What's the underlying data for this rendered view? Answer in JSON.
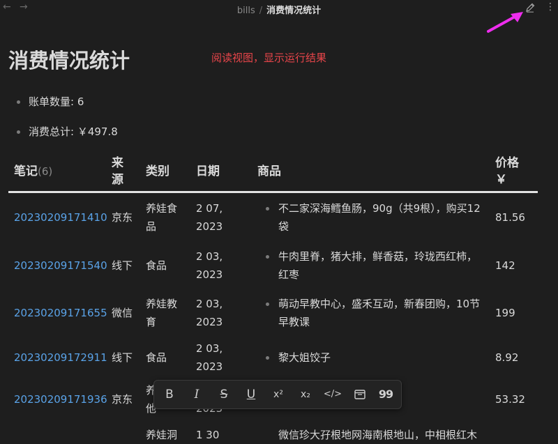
{
  "header": {
    "back": "←",
    "forward": "→",
    "folder": "bills",
    "separator": "/",
    "file": "消费情况统计",
    "edit_icon": "pencil-icon",
    "more": "⋮"
  },
  "title": "消费情况统计",
  "annotation": "阅读视图，显示运行结果",
  "summary": [
    "账单数量: 6",
    "消费总计: ￥497.8"
  ],
  "table": {
    "headers": {
      "note": "笔记",
      "note_count": "(6)",
      "source_1": "来",
      "source_2": "源",
      "category": "类别",
      "date": "日期",
      "product": "商品",
      "price_1": "价格",
      "price_2": "￥"
    },
    "rows": [
      {
        "note": "20230209171410",
        "source": "京东",
        "cat_1": "养娃食",
        "cat_2": "品",
        "date_1": "2 07,",
        "date_2": "2023",
        "prod_1": "不二家深海鳕鱼肠，90g（共9根），购买12",
        "prod_2": "袋",
        "price": "81.56"
      },
      {
        "note": "20230209171540",
        "source": "线下",
        "cat_1": "食品",
        "cat_2": "",
        "date_1": "2 03,",
        "date_2": "2023",
        "prod_1": "牛肉里脊，猪大排，鲜香菇，玲珑西红柿，",
        "prod_2": "红枣",
        "price": "142"
      },
      {
        "note": "20230209171655",
        "source": "微信",
        "cat_1": "养娃教",
        "cat_2": "育",
        "date_1": "2 03,",
        "date_2": "2023",
        "prod_1": "萌动早教中心，盛禾互动，新春团购，10节",
        "prod_2": "早教课",
        "price": "199"
      },
      {
        "note": "20230209172911",
        "source": "线下",
        "cat_1": "食品",
        "cat_2": "",
        "date_1": "2 03,",
        "date_2": "2023",
        "prod_1": "黎大姐饺子",
        "prod_2": "",
        "price": "8.92"
      },
      {
        "note": "20230209171936",
        "source": "京东",
        "cat_1": "养",
        "cat_2": "他",
        "date_1": "",
        "date_2": "2023",
        "prod_1": "",
        "prod_2": "",
        "price": "53.32"
      }
    ],
    "partial_row": {
      "category": "养娃洞",
      "date": "1 30",
      "product": "微信珍大孖根地网海南根地山，中相根红木"
    }
  },
  "format_toolbar": {
    "bold": "B",
    "italic": "I",
    "strike": "S",
    "underline": "U",
    "superscript": "x²",
    "subscript": "x₂",
    "code": "</>",
    "embed_icon": "embed-icon",
    "quote": "99"
  }
}
